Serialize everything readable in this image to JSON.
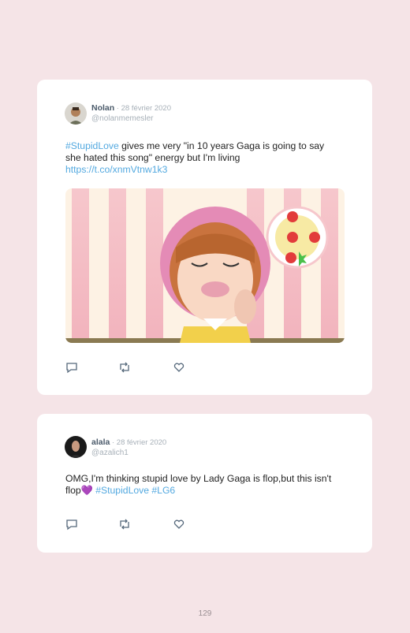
{
  "tweets": [
    {
      "name": "Nolan",
      "date": " · 28 février 2020",
      "handle": "@nolanmemesler",
      "hashtag": "#StupidLove",
      "text": " gives me very \"in 10 years Gaga is going to say she hated this song\" energy but I'm living ",
      "link": "https://t.co/xnmVtnw1k3"
    },
    {
      "name": "alala",
      "date": " · 28 février 2020",
      "handle": "@azalich1",
      "text": "OMG,I'm thinking stupid love by Lady Gaga is flop,but this isn't flop",
      "emoji": "💜",
      "hashtag1": "#StupidLove",
      "hashtag2": "#LG6"
    }
  ],
  "icons": [
    "reply-icon",
    "retweet-icon",
    "like-icon"
  ],
  "page_number": "129",
  "colors": {
    "background": "#f5e4e7",
    "link": "#53a9e0"
  }
}
